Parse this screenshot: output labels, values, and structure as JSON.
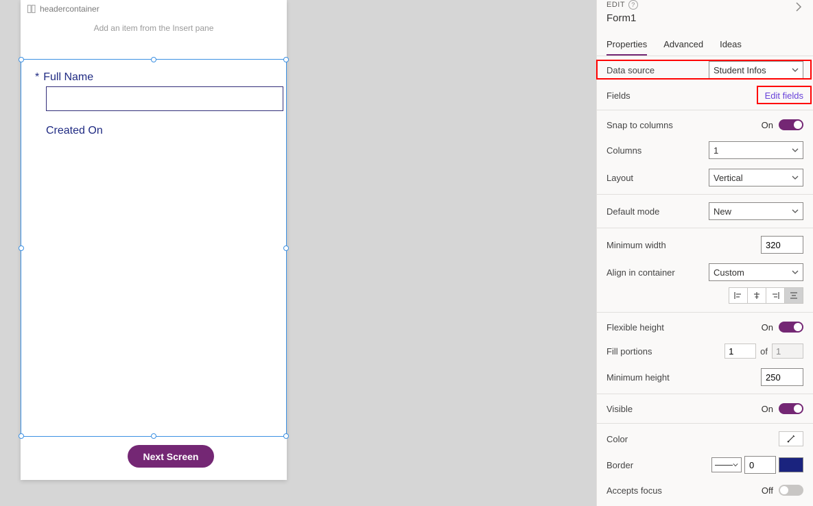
{
  "canvas": {
    "header_container_label": "headercontainer",
    "insert_hint": "Add an item from the Insert pane",
    "required_mark": "*",
    "full_name_label": "Full Name",
    "full_name_value": "",
    "created_on_label": "Created On",
    "next_button": "Next Screen"
  },
  "panel": {
    "edit_label": "EDIT",
    "form_title": "Form1",
    "tabs": {
      "properties": "Properties",
      "advanced": "Advanced",
      "ideas": "Ideas"
    },
    "data_source": {
      "label": "Data source",
      "value": "Student Infos"
    },
    "fields": {
      "label": "Fields",
      "link": "Edit fields"
    },
    "snap": {
      "label": "Snap to columns",
      "state": "On"
    },
    "columns": {
      "label": "Columns",
      "value": "1"
    },
    "layout": {
      "label": "Layout",
      "value": "Vertical"
    },
    "default_mode": {
      "label": "Default mode",
      "value": "New"
    },
    "min_width": {
      "label": "Minimum width",
      "value": "320"
    },
    "align": {
      "label": "Align in container",
      "value": "Custom"
    },
    "flex_height": {
      "label": "Flexible height",
      "state": "On"
    },
    "fill_portions": {
      "label": "Fill portions",
      "value": "1",
      "of_label": "of",
      "of_value": "1"
    },
    "min_height": {
      "label": "Minimum height",
      "value": "250"
    },
    "visible": {
      "label": "Visible",
      "state": "On"
    },
    "color": {
      "label": "Color"
    },
    "border": {
      "label": "Border",
      "value": "0"
    },
    "accepts_focus": {
      "label": "Accepts focus",
      "state": "Off"
    }
  }
}
